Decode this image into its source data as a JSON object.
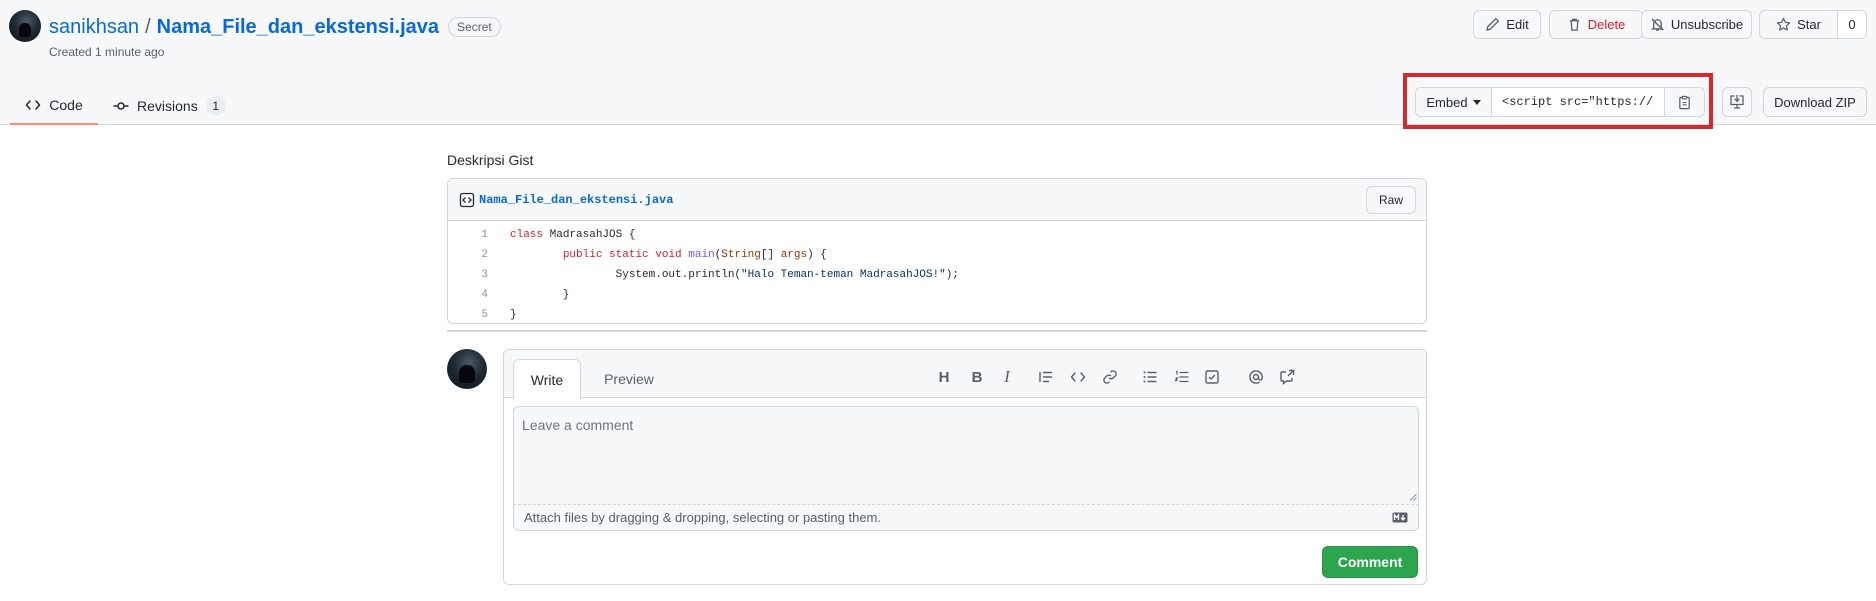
{
  "gist": {
    "owner": "sanikhsan",
    "separator": "/",
    "name": "Nama_File_dan_ekstensi.java",
    "visibility_badge": "Secret",
    "created": "Created 1 minute ago"
  },
  "header_actions": {
    "edit_label": "Edit",
    "delete_label": "Delete",
    "unsubscribe_label": "Unsubscribe",
    "star_label": "Star",
    "star_count": "0"
  },
  "tabs": {
    "code_label": "Code",
    "revisions_label": "Revisions",
    "revisions_count": "1"
  },
  "embed": {
    "select_label": "Embed",
    "input_value": "<script src=\"https://gist.github.com/sanikhsan/",
    "download_zip_label": "Download ZIP"
  },
  "main": {
    "description": "Deskripsi Gist",
    "file": {
      "name": "Nama_File_dan_ekstensi.java",
      "raw_label": "Raw",
      "line_numbers": [
        "1",
        "2",
        "3",
        "4",
        "5"
      ]
    }
  },
  "comment": {
    "write_tab": "Write",
    "preview_tab": "Preview",
    "toolbar_heading": "H",
    "toolbar_bold": "B",
    "toolbar_italic": "I",
    "placeholder": "Leave a comment",
    "attach_text": "Attach files by dragging & dropping, selecting or pasting them.",
    "submit_label": "Comment"
  },
  "colors": {
    "link_blue": "#0969da",
    "danger_red": "#cf222e",
    "success_green": "#2da44e",
    "highlight_red": "#d62a2a",
    "tab_underline": "#fd8c73"
  },
  "icons": [
    "pencil-icon",
    "trash-icon",
    "bell-slash-icon",
    "star-icon",
    "code-icon",
    "git-commit-icon",
    "clipboard-icon",
    "desktop-download-icon",
    "file-code-icon",
    "quote-icon",
    "link-icon",
    "list-unordered-icon",
    "list-ordered-icon",
    "tasklist-icon",
    "mention-icon",
    "cross-reference-icon",
    "markdown-icon"
  ]
}
